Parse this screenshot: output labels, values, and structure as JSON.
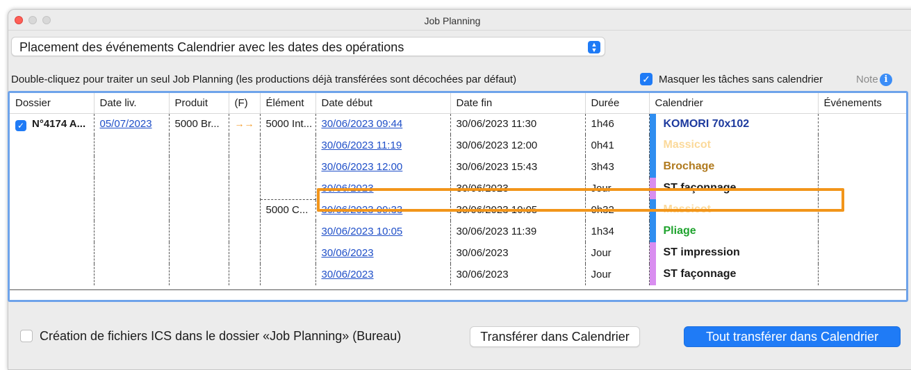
{
  "window": {
    "title": "Job Planning"
  },
  "popup": {
    "value": "Placement des événements Calendrier avec les dates des opérations"
  },
  "hint": "Double-cliquez pour traiter un seul Job Planning (les productions déjà transférées sont décochées par défaut)",
  "mask": {
    "label": "Masquer les tâches sans calendrier",
    "checked": true
  },
  "note_label": "Note",
  "info_icon": "i",
  "columns": [
    "Dossier",
    "Date liv.",
    "Produit",
    "(F)",
    "Élément",
    "Date début",
    "Date fin",
    "Durée",
    "Calendrier",
    "Événements"
  ],
  "job": {
    "dossier": "N°4174 A...",
    "date_liv": "05/07/2023",
    "produit": "5000 Br...",
    "f_icon": "→→"
  },
  "elements": [
    "5000 Int...",
    "5000 C..."
  ],
  "rows": [
    {
      "debut": "30/06/2023 09:44",
      "fin": "30/06/2023 11:30",
      "duree": "1h46",
      "cal": "KOMORI 70x102",
      "bar": "#2f8ef0",
      "color": "#1d3a9e"
    },
    {
      "debut": "30/06/2023 11:19",
      "fin": "30/06/2023 12:00",
      "duree": "0h41",
      "cal": "Massicot",
      "bar": "#2f8ef0",
      "color": "#fbd99a"
    },
    {
      "debut": "30/06/2023 12:00",
      "fin": "30/06/2023 15:43",
      "duree": "3h43",
      "cal": "Brochage",
      "bar": "#2f8ef0",
      "color": "#b07a1e"
    },
    {
      "debut": "30/06/2023",
      "fin": "30/06/2023",
      "duree": "Jour",
      "cal": "ST façonnage",
      "bar": "#d98ef0",
      "color": "#1a1a1a"
    },
    {
      "debut": "30/06/2023 09:33",
      "fin": "30/06/2023 10:05",
      "duree": "0h32",
      "cal": "Massicot",
      "bar": "#2f8ef0",
      "color": "#fbd99a"
    },
    {
      "debut": "30/06/2023 10:05",
      "fin": "30/06/2023 11:39",
      "duree": "1h34",
      "cal": "Pliage",
      "bar": "#2f8ef0",
      "color": "#1fa32e"
    },
    {
      "debut": "30/06/2023",
      "fin": "30/06/2023",
      "duree": "Jour",
      "cal": "ST impression",
      "bar": "#d98ef0",
      "color": "#1a1a1a"
    },
    {
      "debut": "30/06/2023",
      "fin": "30/06/2023",
      "duree": "Jour",
      "cal": "ST façonnage",
      "bar": "#d98ef0",
      "color": "#1a1a1a"
    }
  ],
  "ics": {
    "label": "Création de fichiers ICS dans le dossier «Job Planning» (Bureau)",
    "checked": false
  },
  "buttons": {
    "transfer": "Transférer dans Calendrier",
    "transfer_all": "Tout transférer dans Calendrier"
  },
  "colors": {
    "accent": "#1f7bf6",
    "highlight": "#f2951a",
    "table_border": "#6ea3ea"
  }
}
